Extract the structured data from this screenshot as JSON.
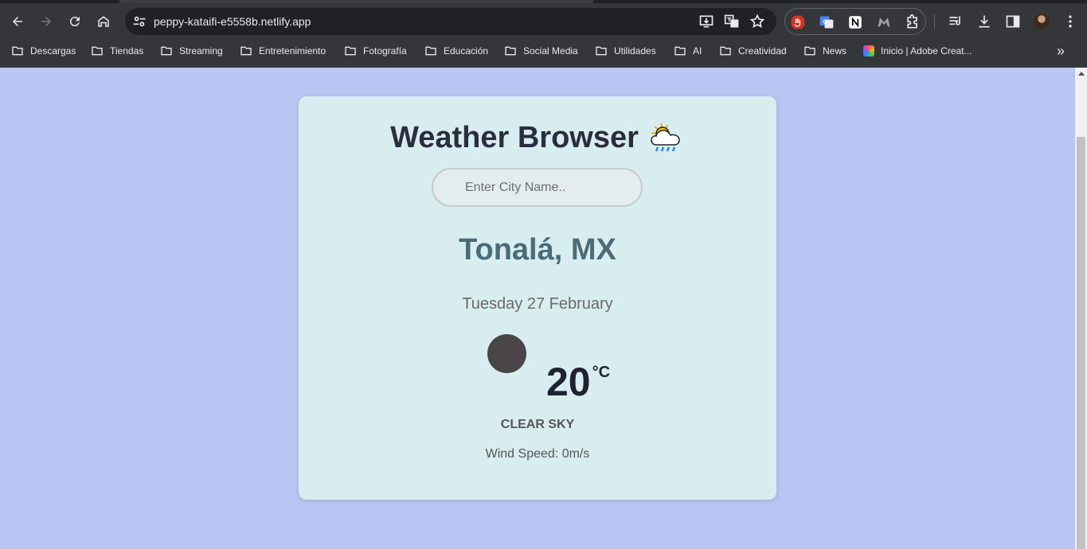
{
  "browser": {
    "url": "peppy-kataifi-e5558b.netlify.app",
    "bookmarks": [
      {
        "label": "Descargas"
      },
      {
        "label": "Tiendas"
      },
      {
        "label": "Streaming"
      },
      {
        "label": "Entretenimiento"
      },
      {
        "label": "Fotografía"
      },
      {
        "label": "Educación"
      },
      {
        "label": "Social Media"
      },
      {
        "label": "Utilidades"
      },
      {
        "label": "AI"
      },
      {
        "label": "Creatividad"
      },
      {
        "label": "News"
      },
      {
        "label": "Inicio | Adobe Creat..."
      }
    ],
    "overflow_label": "»"
  },
  "app": {
    "title": "Weather Browser",
    "title_icon": "sun-behind-rain-cloud-icon",
    "search": {
      "placeholder": "Enter City Name..",
      "value": ""
    },
    "city": "Tonalá, MX",
    "date": "Tuesday 27 February",
    "temperature": "20",
    "unit": "°C",
    "description": "clear sky",
    "wind_label": "Wind Speed: ",
    "wind_value": "0m/s"
  },
  "colors": {
    "page_background": "#b7c6f2",
    "card_background": "#d8edf0",
    "title": "#2a2d3e",
    "city": "#4a6b78"
  }
}
